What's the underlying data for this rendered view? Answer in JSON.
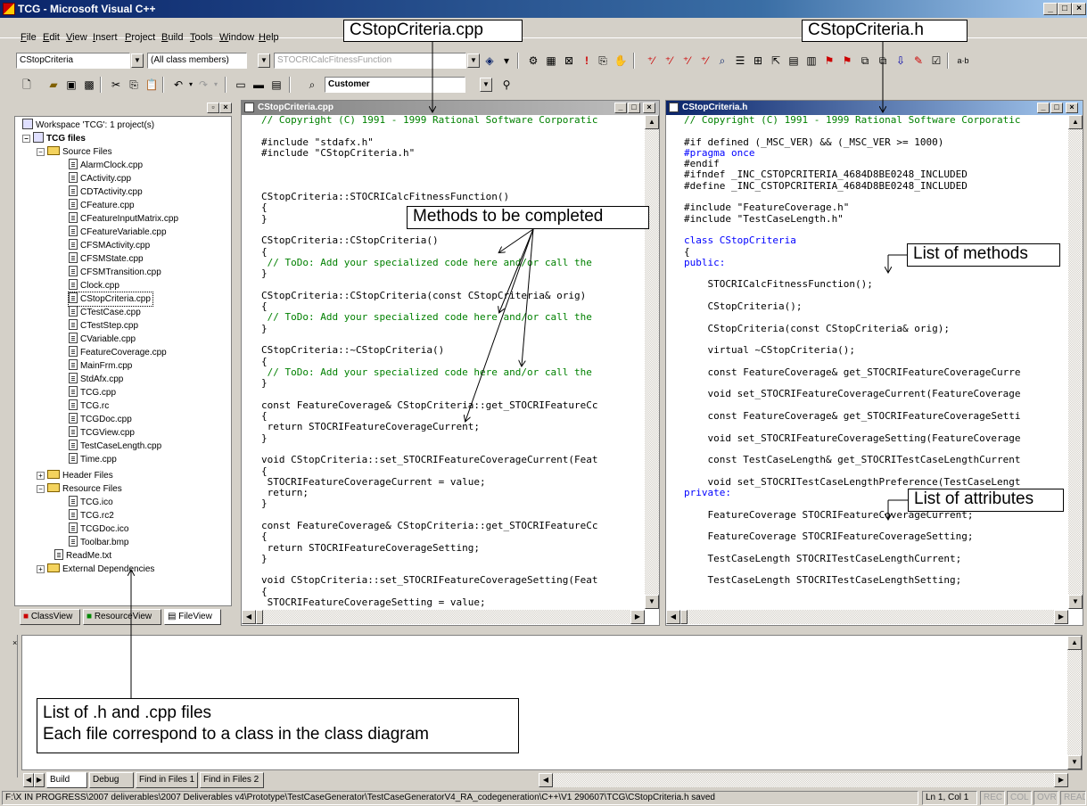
{
  "window": {
    "title": "TCG - Microsoft Visual C++",
    "controls": [
      "_",
      "□",
      "×"
    ]
  },
  "menu": [
    "File",
    "Edit",
    "View",
    "Insert",
    "Project",
    "Build",
    "Tools",
    "Window",
    "Help"
  ],
  "toolbar": {
    "class_combo": "CStopCriteria",
    "members_combo": "(All class members)",
    "function_combo": "STOCRICalcFitnessFunction",
    "config_combo": "Customer"
  },
  "workspace": {
    "title": "Workspace 'TCG': 1 project(s)",
    "project": "TCG files",
    "source_folder": "Source Files",
    "source_files": [
      "AlarmClock.cpp",
      "CActivity.cpp",
      "CDTActivity.cpp",
      "CFeature.cpp",
      "CFeatureInputMatrix.cpp",
      "CFeatureVariable.cpp",
      "CFSMActivity.cpp",
      "CFSMState.cpp",
      "CFSMTransition.cpp",
      "Clock.cpp",
      "CStopCriteria.cpp",
      "CTestCase.cpp",
      "CTestStep.cpp",
      "CVariable.cpp",
      "FeatureCoverage.cpp",
      "MainFrm.cpp",
      "StdAfx.cpp",
      "TCG.cpp",
      "TCG.rc",
      "TCGDoc.cpp",
      "TCGView.cpp",
      "TestCaseLength.cpp",
      "Time.cpp"
    ],
    "header_folder": "Header Files",
    "resource_folder": "Resource Files",
    "resource_files": [
      "TCG.ico",
      "TCG.rc2",
      "TCGDoc.ico",
      "Toolbar.bmp"
    ],
    "readme": "ReadMe.txt",
    "external": "External Dependencies",
    "selected": "CStopCriteria.cpp",
    "tabs": [
      "ClassView",
      "ResourceView",
      "FileView"
    ]
  },
  "cpp_editor": {
    "title": "CStopCriteria.cpp",
    "lines": [
      {
        "t": "// Copyright (C) 1991 - 1999 Rational Software Corporatic",
        "c": "cm"
      },
      {
        "t": "",
        "c": "tx"
      },
      {
        "t": "#include \"stdafx.h\"",
        "c": "tx"
      },
      {
        "t": "#include \"CStopCriteria.h\"",
        "c": "tx"
      },
      {
        "t": "",
        "c": "tx"
      },
      {
        "t": "",
        "c": "tx"
      },
      {
        "t": "",
        "c": "tx"
      },
      {
        "t": "CStopCriteria::STOCRICalcFitnessFunction()",
        "c": "tx"
      },
      {
        "t": "{",
        "c": "tx"
      },
      {
        "t": "}",
        "c": "tx"
      },
      {
        "t": "",
        "c": "tx"
      },
      {
        "t": "CStopCriteria::CStopCriteria()",
        "c": "tx"
      },
      {
        "t": "{",
        "c": "tx"
      },
      {
        "t": " // ToDo: Add your specialized code here and/or call the",
        "c": "cm"
      },
      {
        "t": "}",
        "c": "tx"
      },
      {
        "t": "",
        "c": "tx"
      },
      {
        "t": "CStopCriteria::CStopCriteria(const CStopCriteria& orig)",
        "c": "tx"
      },
      {
        "t": "{",
        "c": "tx"
      },
      {
        "t": " // ToDo: Add your specialized code here and/or call the",
        "c": "cm"
      },
      {
        "t": "}",
        "c": "tx"
      },
      {
        "t": "",
        "c": "tx"
      },
      {
        "t": "CStopCriteria::~CStopCriteria()",
        "c": "tx"
      },
      {
        "t": "{",
        "c": "tx"
      },
      {
        "t": " // ToDo: Add your specialized code here and/or call the",
        "c": "cm"
      },
      {
        "t": "}",
        "c": "tx"
      },
      {
        "t": "",
        "c": "tx"
      },
      {
        "t": "const FeatureCoverage& CStopCriteria::get_STOCRIFeatureCc",
        "c": "tx"
      },
      {
        "t": "{",
        "c": "tx"
      },
      {
        "t": " return STOCRIFeatureCoverageCurrent;",
        "c": "tx"
      },
      {
        "t": "}",
        "c": "tx"
      },
      {
        "t": "",
        "c": "tx"
      },
      {
        "t": "void CStopCriteria::set_STOCRIFeatureCoverageCurrent(Feat",
        "c": "tx"
      },
      {
        "t": "{",
        "c": "tx"
      },
      {
        "t": " STOCRIFeatureCoverageCurrent = value;",
        "c": "tx"
      },
      {
        "t": " return;",
        "c": "tx"
      },
      {
        "t": "}",
        "c": "tx"
      },
      {
        "t": "",
        "c": "tx"
      },
      {
        "t": "const FeatureCoverage& CStopCriteria::get_STOCRIFeatureCc",
        "c": "tx"
      },
      {
        "t": "{",
        "c": "tx"
      },
      {
        "t": " return STOCRIFeatureCoverageSetting;",
        "c": "tx"
      },
      {
        "t": "}",
        "c": "tx"
      },
      {
        "t": "",
        "c": "tx"
      },
      {
        "t": "void CStopCriteria::set_STOCRIFeatureCoverageSetting(Feat",
        "c": "tx"
      },
      {
        "t": "{",
        "c": "tx"
      },
      {
        "t": " STOCRIFeatureCoverageSetting = value;",
        "c": "tx"
      }
    ]
  },
  "h_editor": {
    "title": "CStopCriteria.h",
    "lines": [
      {
        "t": "// Copyright (C) 1991 - 1999 Rational Software Corporatic",
        "c": "cm"
      },
      {
        "t": "",
        "c": "tx"
      },
      {
        "t": "#if defined (_MSC_VER) && (_MSC_VER >= 1000)",
        "c": "tx"
      },
      {
        "t": "#pragma once",
        "c": "kw"
      },
      {
        "t": "#endif",
        "c": "tx"
      },
      {
        "t": "#ifndef _INC_CSTOPCRITERIA_4684D8BE0248_INCLUDED",
        "c": "tx"
      },
      {
        "t": "#define _INC_CSTOPCRITERIA_4684D8BE0248_INCLUDED",
        "c": "tx"
      },
      {
        "t": "",
        "c": "tx"
      },
      {
        "t": "#include \"FeatureCoverage.h\"",
        "c": "tx"
      },
      {
        "t": "#include \"TestCaseLength.h\"",
        "c": "tx"
      },
      {
        "t": "",
        "c": "tx"
      },
      {
        "t": "class CStopCriteria",
        "c": "kw"
      },
      {
        "t": "{",
        "c": "tx"
      },
      {
        "t": "public:",
        "c": "kw"
      },
      {
        "t": "",
        "c": "tx"
      },
      {
        "t": "    STOCRICalcFitnessFunction();",
        "c": "tx"
      },
      {
        "t": "",
        "c": "tx"
      },
      {
        "t": "    CStopCriteria();",
        "c": "tx"
      },
      {
        "t": "",
        "c": "tx"
      },
      {
        "t": "    CStopCriteria(const CStopCriteria& orig);",
        "c": "tx"
      },
      {
        "t": "",
        "c": "tx"
      },
      {
        "t": "    virtual ~CStopCriteria();",
        "c": "tx"
      },
      {
        "t": "",
        "c": "tx"
      },
      {
        "t": "    const FeatureCoverage& get_STOCRIFeatureCoverageCurre",
        "c": "tx"
      },
      {
        "t": "",
        "c": "tx"
      },
      {
        "t": "    void set_STOCRIFeatureCoverageCurrent(FeatureCoverage",
        "c": "tx"
      },
      {
        "t": "",
        "c": "tx"
      },
      {
        "t": "    const FeatureCoverage& get_STOCRIFeatureCoverageSetti",
        "c": "tx"
      },
      {
        "t": "",
        "c": "tx"
      },
      {
        "t": "    void set_STOCRIFeatureCoverageSetting(FeatureCoverage",
        "c": "tx"
      },
      {
        "t": "",
        "c": "tx"
      },
      {
        "t": "    const TestCaseLength& get_STOCRITestCaseLengthCurrent",
        "c": "tx"
      },
      {
        "t": "",
        "c": "tx"
      },
      {
        "t": "    void set_STOCRITestCaseLengthPreference(TestCaseLengt",
        "c": "tx"
      },
      {
        "t": "private:",
        "c": "kw"
      },
      {
        "t": "",
        "c": "tx"
      },
      {
        "t": "    FeatureCoverage STOCRIFeatureCoverageCurrent;",
        "c": "tx"
      },
      {
        "t": "",
        "c": "tx"
      },
      {
        "t": "    FeatureCoverage STOCRIFeatureCoverageSetting;",
        "c": "tx"
      },
      {
        "t": "",
        "c": "tx"
      },
      {
        "t": "    TestCaseLength STOCRITestCaseLengthCurrent;",
        "c": "tx"
      },
      {
        "t": "",
        "c": "tx"
      },
      {
        "t": "    TestCaseLength STOCRITestCaseLengthSetting;",
        "c": "tx"
      }
    ]
  },
  "output_tabs": [
    "Build",
    "Debug",
    "Find in Files 1",
    "Find in Files 2"
  ],
  "status": {
    "path": "F:\\X IN PROGRESS\\2007 deliverables\\2007 Deliverables v4\\Prototype\\TestCaseGenerator\\TestCaseGeneratorV4_RA_codegeneration\\C++\\V1 290607\\TCG\\CStopCriteria.h saved",
    "position": "Ln 1, Col 1",
    "indicators": [
      "REC",
      "COL",
      "OVR",
      "READ"
    ]
  },
  "annotations": {
    "cpp_label": "CStopCriteria.cpp",
    "h_label": "CStopCriteria.h",
    "methods_to_complete": "Methods to be completed",
    "list_of_methods": "List of methods",
    "list_of_attributes": "List of attributes",
    "files_line1": "List of .h and .cpp files",
    "files_line2": "Each file correspond to a class in the class diagram"
  }
}
